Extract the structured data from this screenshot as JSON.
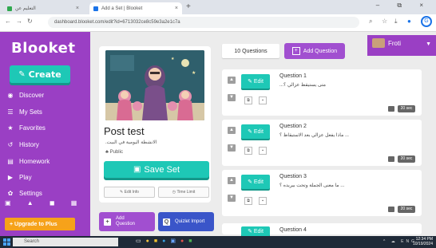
{
  "browser": {
    "tabs": [
      {
        "label": "التعليم عن",
        "active": false,
        "favicon_color": "#2fa84f"
      },
      {
        "label": "Add a Set | Blooket",
        "active": true,
        "favicon_color": "#1a73e8"
      }
    ],
    "new_tab_label": "+",
    "window_controls": "–  ⧉  ×",
    "url": "dashboard.blooket.com/edit?id=6713032ce8c59e3a2e1c7a",
    "profile_letter": "G"
  },
  "sidebar": {
    "logo": "Blooket",
    "create_label": "Create",
    "items": [
      {
        "label": "Discover",
        "icon": "compass-icon",
        "glyph": "◉"
      },
      {
        "label": "My Sets",
        "icon": "list-icon",
        "glyph": "☰"
      },
      {
        "label": "Favorites",
        "icon": "star-icon",
        "glyph": "★"
      },
      {
        "label": "History",
        "icon": "history-icon",
        "glyph": "↺"
      },
      {
        "label": "Homework",
        "icon": "document-icon",
        "glyph": "▤"
      },
      {
        "label": "Play",
        "icon": "play-icon",
        "glyph": "▶"
      },
      {
        "label": "Settings",
        "icon": "gear-icon",
        "glyph": "✿"
      }
    ],
    "bottom_icons": "▣ ▲ ◼ ▦",
    "upgrade_label": "+ Upgrade to Plus"
  },
  "set": {
    "title": "Post test",
    "description": "الانشطة اليومية في البيت.",
    "visibility": "Public",
    "save_label": "Save Set",
    "edit_info_label": "Edit Info",
    "time_limit_label": "Time Limit",
    "add_question_label": "Add Question",
    "quizlet_import_label": "Quizlet Import"
  },
  "questions_header": {
    "count_label": "10 Questions",
    "add_question_label": "Add Question"
  },
  "user": {
    "name": "Froti"
  },
  "questions": [
    {
      "title": "Question 1",
      "text": "...متى يستيقظ عزالي ؟",
      "time": "20 sec"
    },
    {
      "title": "Question 2",
      "text": "ماذا يفعل عزالي بعد الاستيقاظ ؟ ...",
      "time": "20 sec"
    },
    {
      "title": "Question 3",
      "text": "ما معنى الجملة وتحت بيريده ؟ ...",
      "time": "20 sec"
    },
    {
      "title": "Question 4",
      "text": "",
      "time": ""
    }
  ],
  "edit_label": "Edit",
  "taskbar": {
    "search_placeholder": "Search",
    "tray": "^ ☁ ENG",
    "time": "12:34 PM",
    "date": "10/19/2024"
  },
  "colors": {
    "sidebar": "#9a3fc4",
    "accent_teal": "#1ec8b6",
    "add_purple": "#a14fd0",
    "quizlet_blue": "#3a55c9",
    "upgrade_orange": "#f6a21a"
  }
}
